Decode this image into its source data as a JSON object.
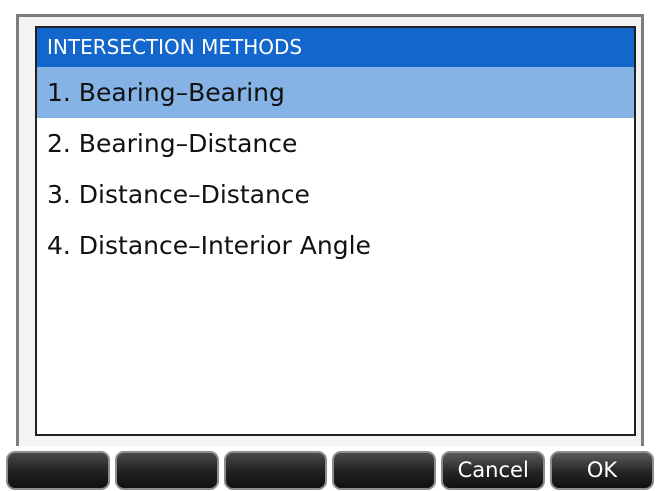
{
  "dialog": {
    "title": "INTERSECTION METHODS",
    "items": [
      {
        "label": "1. Bearing–Bearing",
        "selected": true
      },
      {
        "label": "2. Bearing–Distance",
        "selected": false
      },
      {
        "label": "3. Distance–Distance",
        "selected": false
      },
      {
        "label": "4. Distance–Interior Angle",
        "selected": false
      }
    ]
  },
  "softkeys": [
    "",
    "",
    "",
    "",
    "Cancel",
    "OK"
  ],
  "colors": {
    "title_bar": "#1266cc",
    "selected_row": "#86b3e6",
    "softkey": "#1f1f1f"
  }
}
